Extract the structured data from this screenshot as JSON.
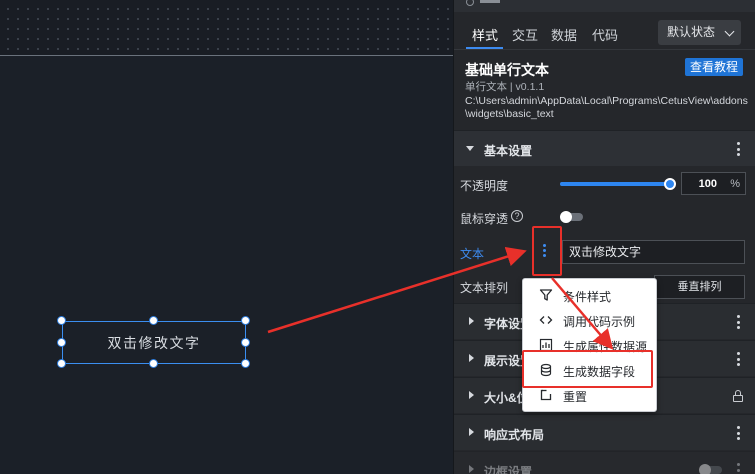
{
  "canvas": {
    "widget_text": "双击修改文字"
  },
  "panel": {
    "tabs": [
      {
        "label": "样式"
      },
      {
        "label": "交互"
      },
      {
        "label": "数据"
      },
      {
        "label": "代码"
      }
    ],
    "state_select": "默认状态",
    "widget_title": "基础单行文本",
    "tutorial_button": "查看教程",
    "widget_subtitle": "单行文本 | v0.1.1",
    "widget_path": "C:\\Users\\admin\\AppData\\Local\\Programs\\CetusView\\addons\\widgets\\basic_text",
    "basic_settings": {
      "title": "基本设置",
      "opacity_label": "不透明度",
      "opacity_value": "100",
      "opacity_unit": "%",
      "opacity_fraction": 1.0,
      "mouse_through_label": "鼠标穿透",
      "text_label": "文本",
      "text_value": "双击修改文字",
      "arrange_label": "文本排列",
      "arrange_vertical": "垂直排列"
    },
    "sections": [
      {
        "title": "字体设置"
      },
      {
        "title": "展示设置"
      },
      {
        "title": "大小&位置"
      },
      {
        "title": "响应式布局"
      },
      {
        "title": "边框设置"
      }
    ]
  },
  "context_menu": {
    "items": [
      {
        "label": "条件样式",
        "icon": "filter-icon"
      },
      {
        "label": "调用代码示例",
        "icon": "code-icon"
      },
      {
        "label": "生成属性数据源",
        "icon": "chart-icon"
      },
      {
        "label": "生成数据字段",
        "icon": "database-icon"
      },
      {
        "label": "重置",
        "icon": "reset-icon"
      }
    ]
  },
  "colors": {
    "accent": "#3d8bf0",
    "annotation": "#e8302a"
  }
}
